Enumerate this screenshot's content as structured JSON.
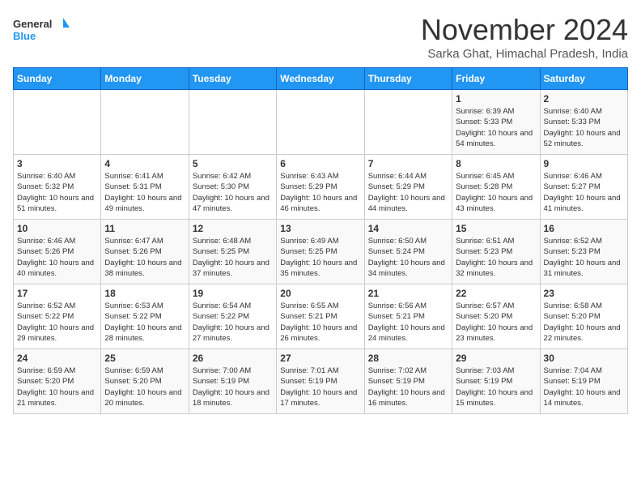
{
  "header": {
    "logo_line1": "General",
    "logo_line2": "Blue",
    "month": "November 2024",
    "location": "Sarka Ghat, Himachal Pradesh, India"
  },
  "weekdays": [
    "Sunday",
    "Monday",
    "Tuesday",
    "Wednesday",
    "Thursday",
    "Friday",
    "Saturday"
  ],
  "weeks": [
    [
      {
        "day": "",
        "info": ""
      },
      {
        "day": "",
        "info": ""
      },
      {
        "day": "",
        "info": ""
      },
      {
        "day": "",
        "info": ""
      },
      {
        "day": "",
        "info": ""
      },
      {
        "day": "1",
        "info": "Sunrise: 6:39 AM\nSunset: 5:33 PM\nDaylight: 10 hours and 54 minutes."
      },
      {
        "day": "2",
        "info": "Sunrise: 6:40 AM\nSunset: 5:33 PM\nDaylight: 10 hours and 52 minutes."
      }
    ],
    [
      {
        "day": "3",
        "info": "Sunrise: 6:40 AM\nSunset: 5:32 PM\nDaylight: 10 hours and 51 minutes."
      },
      {
        "day": "4",
        "info": "Sunrise: 6:41 AM\nSunset: 5:31 PM\nDaylight: 10 hours and 49 minutes."
      },
      {
        "day": "5",
        "info": "Sunrise: 6:42 AM\nSunset: 5:30 PM\nDaylight: 10 hours and 47 minutes."
      },
      {
        "day": "6",
        "info": "Sunrise: 6:43 AM\nSunset: 5:29 PM\nDaylight: 10 hours and 46 minutes."
      },
      {
        "day": "7",
        "info": "Sunrise: 6:44 AM\nSunset: 5:29 PM\nDaylight: 10 hours and 44 minutes."
      },
      {
        "day": "8",
        "info": "Sunrise: 6:45 AM\nSunset: 5:28 PM\nDaylight: 10 hours and 43 minutes."
      },
      {
        "day": "9",
        "info": "Sunrise: 6:46 AM\nSunset: 5:27 PM\nDaylight: 10 hours and 41 minutes."
      }
    ],
    [
      {
        "day": "10",
        "info": "Sunrise: 6:46 AM\nSunset: 5:26 PM\nDaylight: 10 hours and 40 minutes."
      },
      {
        "day": "11",
        "info": "Sunrise: 6:47 AM\nSunset: 5:26 PM\nDaylight: 10 hours and 38 minutes."
      },
      {
        "day": "12",
        "info": "Sunrise: 6:48 AM\nSunset: 5:25 PM\nDaylight: 10 hours and 37 minutes."
      },
      {
        "day": "13",
        "info": "Sunrise: 6:49 AM\nSunset: 5:25 PM\nDaylight: 10 hours and 35 minutes."
      },
      {
        "day": "14",
        "info": "Sunrise: 6:50 AM\nSunset: 5:24 PM\nDaylight: 10 hours and 34 minutes."
      },
      {
        "day": "15",
        "info": "Sunrise: 6:51 AM\nSunset: 5:23 PM\nDaylight: 10 hours and 32 minutes."
      },
      {
        "day": "16",
        "info": "Sunrise: 6:52 AM\nSunset: 5:23 PM\nDaylight: 10 hours and 31 minutes."
      }
    ],
    [
      {
        "day": "17",
        "info": "Sunrise: 6:52 AM\nSunset: 5:22 PM\nDaylight: 10 hours and 29 minutes."
      },
      {
        "day": "18",
        "info": "Sunrise: 6:53 AM\nSunset: 5:22 PM\nDaylight: 10 hours and 28 minutes."
      },
      {
        "day": "19",
        "info": "Sunrise: 6:54 AM\nSunset: 5:22 PM\nDaylight: 10 hours and 27 minutes."
      },
      {
        "day": "20",
        "info": "Sunrise: 6:55 AM\nSunset: 5:21 PM\nDaylight: 10 hours and 26 minutes."
      },
      {
        "day": "21",
        "info": "Sunrise: 6:56 AM\nSunset: 5:21 PM\nDaylight: 10 hours and 24 minutes."
      },
      {
        "day": "22",
        "info": "Sunrise: 6:57 AM\nSunset: 5:20 PM\nDaylight: 10 hours and 23 minutes."
      },
      {
        "day": "23",
        "info": "Sunrise: 6:58 AM\nSunset: 5:20 PM\nDaylight: 10 hours and 22 minutes."
      }
    ],
    [
      {
        "day": "24",
        "info": "Sunrise: 6:59 AM\nSunset: 5:20 PM\nDaylight: 10 hours and 21 minutes."
      },
      {
        "day": "25",
        "info": "Sunrise: 6:59 AM\nSunset: 5:20 PM\nDaylight: 10 hours and 20 minutes."
      },
      {
        "day": "26",
        "info": "Sunrise: 7:00 AM\nSunset: 5:19 PM\nDaylight: 10 hours and 18 minutes."
      },
      {
        "day": "27",
        "info": "Sunrise: 7:01 AM\nSunset: 5:19 PM\nDaylight: 10 hours and 17 minutes."
      },
      {
        "day": "28",
        "info": "Sunrise: 7:02 AM\nSunset: 5:19 PM\nDaylight: 10 hours and 16 minutes."
      },
      {
        "day": "29",
        "info": "Sunrise: 7:03 AM\nSunset: 5:19 PM\nDaylight: 10 hours and 15 minutes."
      },
      {
        "day": "30",
        "info": "Sunrise: 7:04 AM\nSunset: 5:19 PM\nDaylight: 10 hours and 14 minutes."
      }
    ]
  ]
}
